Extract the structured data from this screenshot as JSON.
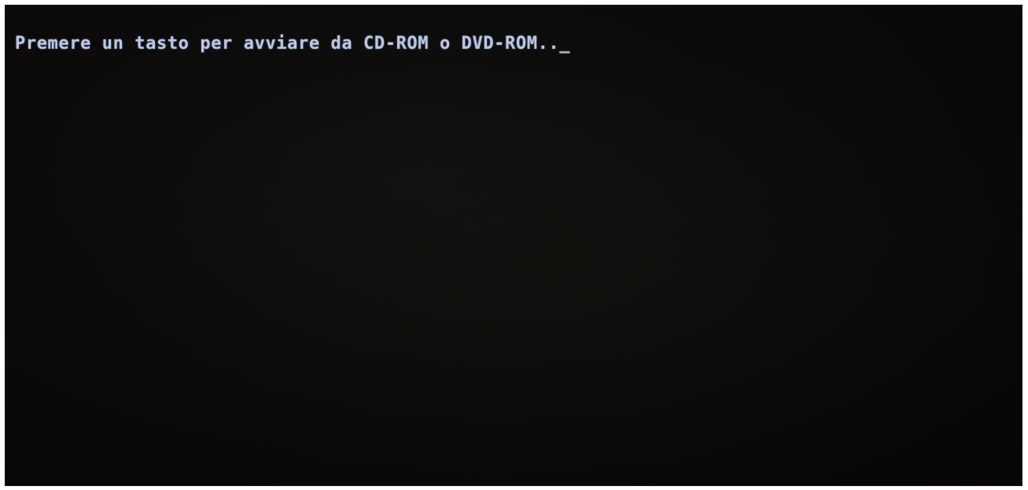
{
  "console": {
    "prompt_text": "Premere un tasto per avviare da CD-ROM o DVD-ROM..",
    "cursor": "_"
  },
  "colors": {
    "background": "#0c0b09",
    "text": "#b9c8e6"
  }
}
